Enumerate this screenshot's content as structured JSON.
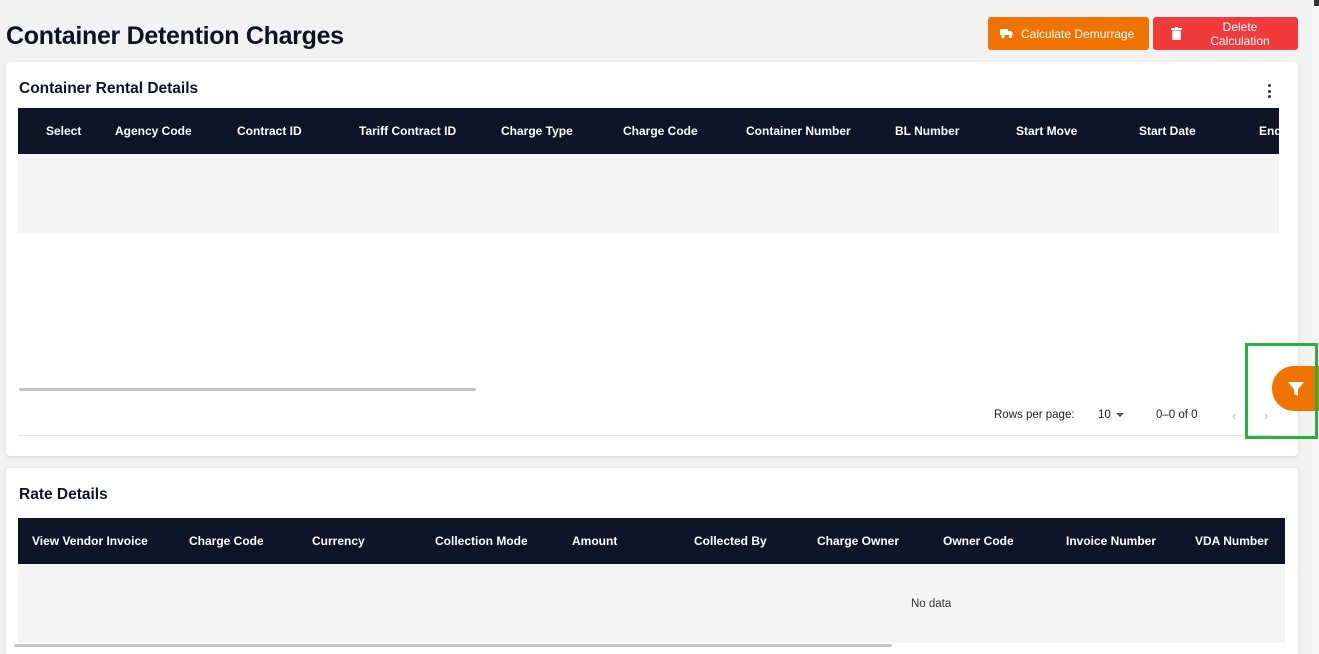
{
  "page": {
    "title": "Container Detention Charges"
  },
  "actions": {
    "calculate_label": "Calculate Demurrage",
    "delete_label": "Delete Calculation",
    "calculate_icon": "truck-icon",
    "delete_icon": "trash-icon"
  },
  "rental_section": {
    "title": "Container Rental Details",
    "columns": [
      "Select",
      "Agency Code",
      "Contract ID",
      "Tariff Contract ID",
      "Charge Type",
      "Charge Code",
      "Container Number",
      "BL Number",
      "Start Move",
      "Start Date",
      "End"
    ],
    "pagination": {
      "rows_per_page_label": "Rows per page:",
      "rows_per_page_value": "10",
      "range_text": "0–0 of 0",
      "prev": "‹",
      "next": "›"
    }
  },
  "rate_section": {
    "title": "Rate Details",
    "columns": [
      "View Vendor Invoice",
      "Charge Code",
      "Currency",
      "Collection Mode",
      "Amount",
      "Collected By",
      "Charge Owner",
      "Owner Code",
      "Invoice Number",
      "VDA Number"
    ],
    "empty_text": "No data"
  },
  "filter_fab": {
    "icon": "filter-icon"
  },
  "colors": {
    "accent_orange": "#f07300",
    "danger_red": "#f13a3a",
    "header_dark": "#0f1528",
    "highlight_green": "#28b13f"
  }
}
